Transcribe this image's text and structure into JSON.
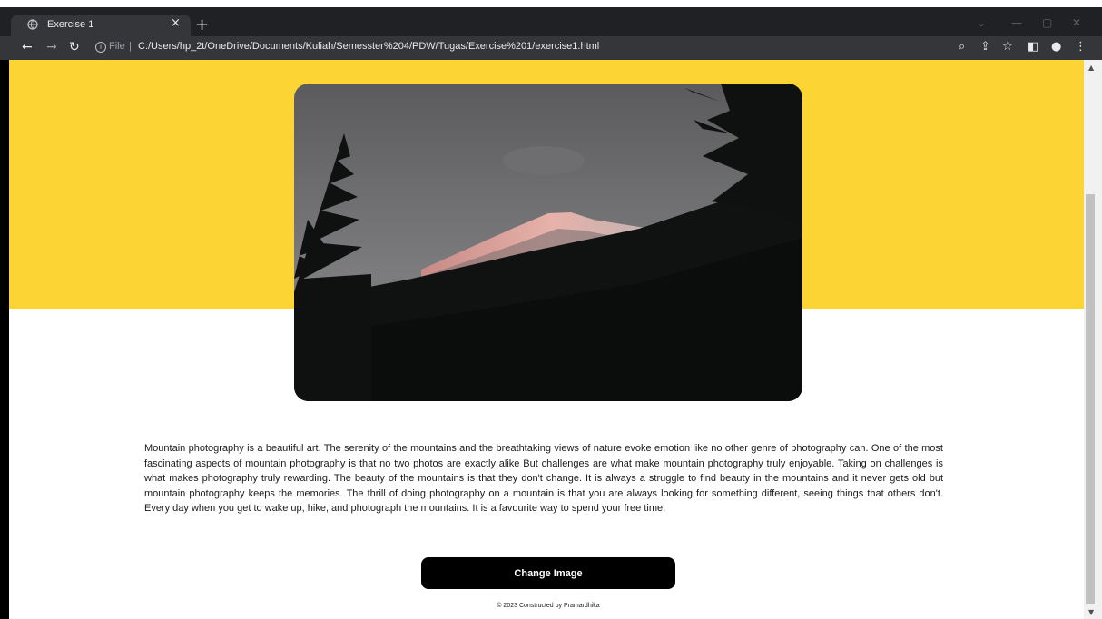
{
  "browser": {
    "tab_title": "Exercise 1",
    "tab_close": "×",
    "new_tab": "+",
    "url_scheme_label": "File",
    "url_separator": "|",
    "url": "C:/Users/hp_2t/OneDrive/Documents/Kuliah/Semesster%204/PDW/Tugas/Exercise%201/exercise1.html",
    "icons": [
      "back-icon",
      "forward-icon",
      "reload-icon",
      "info-icon",
      "zoom-icon",
      "share-icon",
      "star-icon",
      "side-panel-icon",
      "profile-icon",
      "menu-icon",
      "minimize-icon",
      "maximize-icon",
      "close-icon",
      "chevron-down-icon"
    ]
  },
  "page": {
    "paragraph": "Mountain photography is a beautiful art. The serenity of the mountains and the breathtaking views of nature evoke emotion like no other genre of photography can. One of the most fascinating aspects of mountain photography is that no two photos are exactly alike But challenges are what make mountain photography truly enjoyable. Taking on challenges is what makes photography truly rewarding. The beauty of the mountains is that they don't change. It is always a struggle to find beauty in the mountains and it never gets old but mountain photography keeps the memories. The thrill of doing photography on a mountain is that you are always looking for something different, seeing things that others don't. Every day when you get to wake up, hike, and photograph the mountains. It is a favourite way to spend your free time.",
    "button_label": "Change Image",
    "footer": "© 2023 Constructed by Pramardhika"
  },
  "colors": {
    "hero_band": "#fcd535",
    "button": "#000000",
    "chrome_dark": "#202124",
    "chrome_toolbar": "#35363a"
  }
}
